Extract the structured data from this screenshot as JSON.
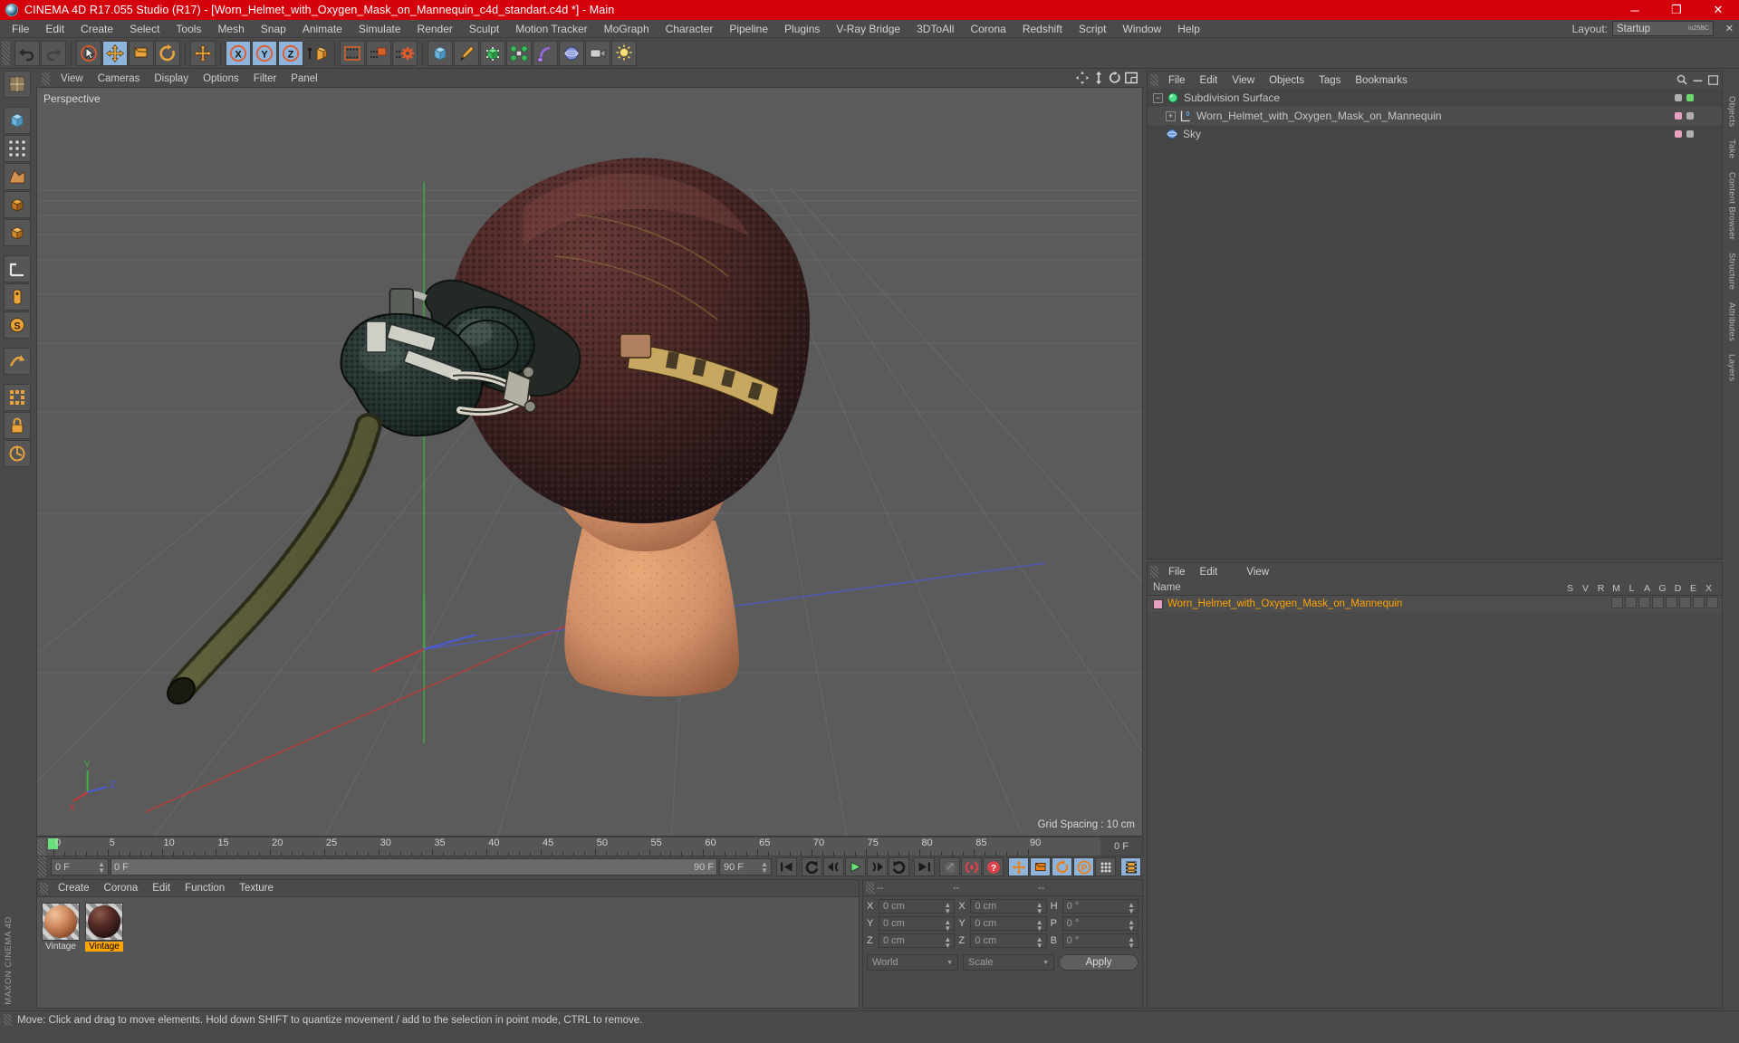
{
  "window": {
    "title": "CINEMA 4D R17.055 Studio (R17) - [Worn_Helmet_with_Oxygen_Mask_on_Mannequin_c4d_standart.c4d *] - Main",
    "minimize": "─",
    "maximize": "❐",
    "close": "✕"
  },
  "menubar": {
    "items": [
      "File",
      "Edit",
      "Create",
      "Select",
      "Tools",
      "Mesh",
      "Snap",
      "Animate",
      "Simulate",
      "Render",
      "Sculpt",
      "Motion Tracker",
      "MoGraph",
      "Character",
      "Pipeline",
      "Plugins",
      "V-Ray Bridge",
      "3DToAll",
      "Corona",
      "Redshift",
      "Script",
      "Window",
      "Help"
    ],
    "layout_label": "Layout:",
    "layout_value": "Startup",
    "close_x": "✕"
  },
  "toolbar": {
    "undo": "undo-icon",
    "redo": "redo-icon",
    "select": "live-selection-icon",
    "move": "move-tool-icon",
    "scale": "scale-tool-icon",
    "rotate": "rotate-tool-icon",
    "move2": "move-axis-icon",
    "axis_x": "X",
    "axis_y": "Y",
    "axis_z": "Z",
    "world": "world-axis-icon",
    "render_view": "render-view-icon",
    "render_region": "render-region-icon",
    "render_settings": "render-settings-icon",
    "cube": "cube-primitive-icon",
    "spline": "pen-spline-icon",
    "nurbs": "generator-icon",
    "array": "array-icon",
    "deformer": "bend-deformer-icon",
    "scene": "scene-object-icon",
    "camera": "camera-icon",
    "light": "light-icon"
  },
  "leftbar": {
    "tools": [
      "texture-axis-icon",
      "point-mode-icon",
      "edge-mode-icon",
      "polygon-mode-icon",
      "model-mode-icon",
      "object-mode-icon",
      "texture-mode-icon",
      "axis-lock-icon",
      "workplane-icon",
      "enable-axis-icon",
      "enable-snap-icon",
      "lock-icon",
      "quantize-icon"
    ],
    "brand": "MAXON CINEMA 4D"
  },
  "viewport": {
    "tabs": [
      "View",
      "Cameras",
      "Display",
      "Options",
      "Filter",
      "Panel"
    ],
    "perspective_label": "Perspective",
    "grid_spacing": "Grid Spacing : 10 cm",
    "axis_labels": {
      "x": "X",
      "y": "Y",
      "z": "Z"
    },
    "nav_icons": [
      "pan-icon",
      "zoom-icon",
      "orbit-icon",
      "maximize-viewport-icon"
    ]
  },
  "timeline": {
    "ticks": [
      0,
      5,
      10,
      15,
      20,
      25,
      30,
      35,
      40,
      45,
      50,
      55,
      60,
      65,
      70,
      75,
      80,
      85,
      90
    ],
    "current_frame": "0 F",
    "scrub_start": "0 F",
    "scrub_end": "90 F",
    "range_end": "90 F",
    "end_label": "0 F",
    "buttons": [
      "go-to-start-icon",
      "play-backwards-icon",
      "previous-frame-icon",
      "play-forward-icon",
      "next-frame-icon",
      "play-loop-icon",
      "go-to-end-icon",
      "record-active-objects-icon",
      "autokeying-icon",
      "keyframe-selection-icon",
      "position-key-icon",
      "scale-key-icon",
      "rotation-key-icon",
      "param-key-icon",
      "point-level-animation-icon",
      "timeline-icon"
    ]
  },
  "material_manager": {
    "menu": [
      "Create",
      "Corona",
      "Edit",
      "Function",
      "Texture"
    ],
    "materials": [
      {
        "name": "Vintage",
        "selected": false,
        "color_a": "#d08a60",
        "color_b": "#8a4a2a"
      },
      {
        "name": "Vintage",
        "selected": true,
        "color_a": "#6a3a32",
        "color_b": "#201210"
      }
    ]
  },
  "coordinates": {
    "header": [
      "--",
      "--",
      "--"
    ],
    "rows": [
      {
        "axis1": "X",
        "val1": "0 cm",
        "axis2": "X",
        "val2": "0 cm",
        "axis3": "H",
        "val3": "0 °"
      },
      {
        "axis1": "Y",
        "val1": "0 cm",
        "axis2": "Y",
        "val2": "0 cm",
        "axis3": "P",
        "val3": "0 °"
      },
      {
        "axis1": "Z",
        "val1": "0 cm",
        "axis2": "Z",
        "val2": "0 cm",
        "axis3": "B",
        "val3": "0 °"
      }
    ],
    "system": "World",
    "mode": "Scale",
    "apply": "Apply"
  },
  "object_manager": {
    "menu": [
      "File",
      "Edit",
      "View",
      "Objects",
      "Tags",
      "Bookmarks"
    ],
    "items": [
      {
        "label": "Subdivision Surface",
        "depth": 0,
        "icon": "subdivision-surface-icon",
        "expander": "−",
        "has_expander": true
      },
      {
        "label": "Worn_Helmet_with_Oxygen_Mask_on_Mannequin",
        "depth": 1,
        "icon": "null-object-icon",
        "expander": "+",
        "has_expander": true
      },
      {
        "label": "Sky",
        "depth": 0,
        "icon": "sky-object-icon",
        "expander": "",
        "has_expander": false
      }
    ]
  },
  "attribute_manager": {
    "menu": [
      "File",
      "Edit",
      "View"
    ],
    "name_column": "Name",
    "flag_columns": [
      "S",
      "V",
      "R",
      "M",
      "L",
      "A",
      "G",
      "D",
      "E",
      "X"
    ],
    "rows": [
      {
        "name": "Worn_Helmet_with_Oxygen_Mask_on_Mannequin",
        "selected": true
      }
    ]
  },
  "right_tabs": [
    "Objects",
    "Take",
    "Content Browser",
    "Structure",
    "Attributes",
    "Layers"
  ],
  "statusbar": {
    "message": "Move: Click and drag to move elements. Hold down SHIFT to quantize movement / add to the selection in point mode, CTRL to remove."
  },
  "colors": {
    "title_red": "#d4000c",
    "panel": "#4a4a4a",
    "viewport": "#5b5b5b",
    "accent_blue": "#8fb4db",
    "accent_orange": "#ffa400",
    "green": "#6adf7d"
  }
}
